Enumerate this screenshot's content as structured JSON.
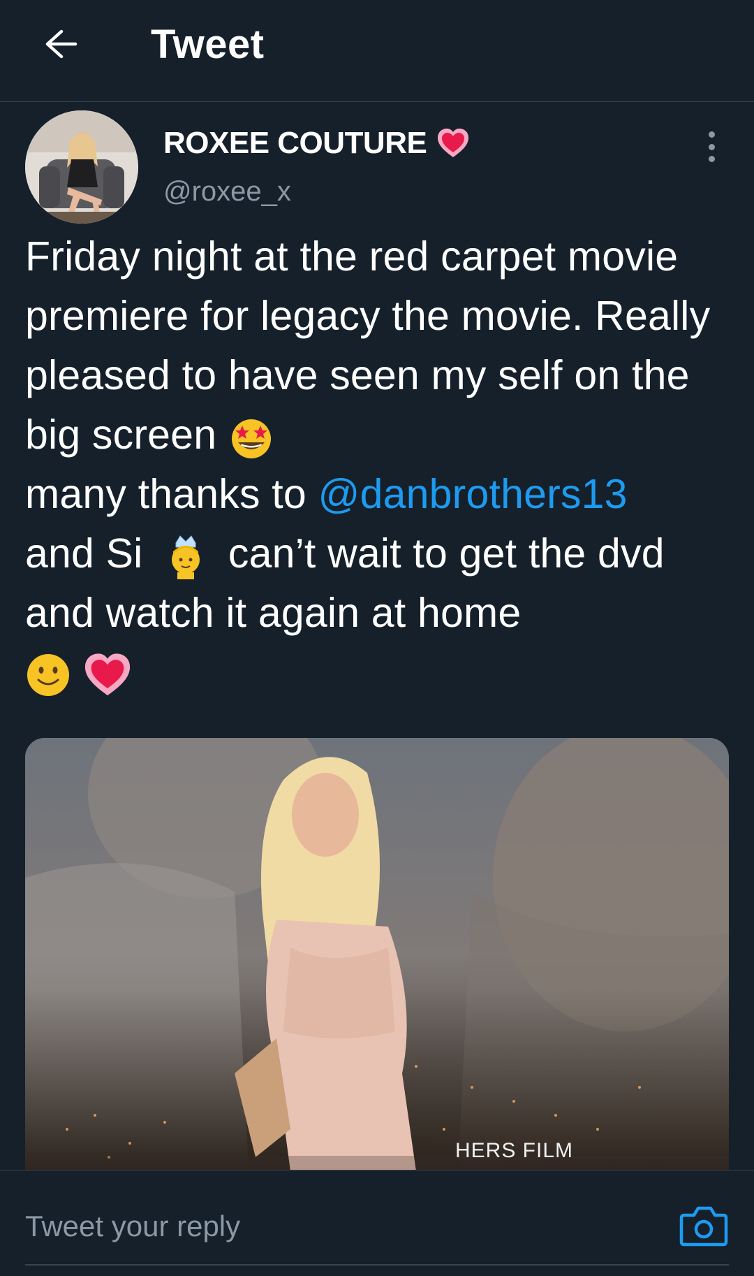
{
  "header": {
    "title": "Tweet",
    "back_icon": "arrow-left-icon"
  },
  "author": {
    "name": "ROXEE COUTURE",
    "handle": "@roxee_x",
    "name_emoji": "heart-icon"
  },
  "tweet": {
    "text_before_mention": "Friday night at the red carpet movie premiere for legacy the movie. Really pleased to have seen my self on the big screen",
    "mention": "@danbrothers13",
    "text_and_si": "and Si",
    "text_after": "can’t wait to get the dvd and watch it again at home",
    "prefix_many_thanks": "many thanks to",
    "emojis": [
      "star-struck-icon",
      "person-with-crown-icon",
      "smiling-face-icon",
      "heart-icon"
    ]
  },
  "media": {
    "caption": "HERS  FILM"
  },
  "reply": {
    "placeholder": "Tweet your reply",
    "camera_icon": "camera-icon"
  },
  "colors": {
    "background": "#15202b",
    "accent": "#1d9bf0",
    "secondary_text": "#8b98a5",
    "divider": "#38444d"
  }
}
